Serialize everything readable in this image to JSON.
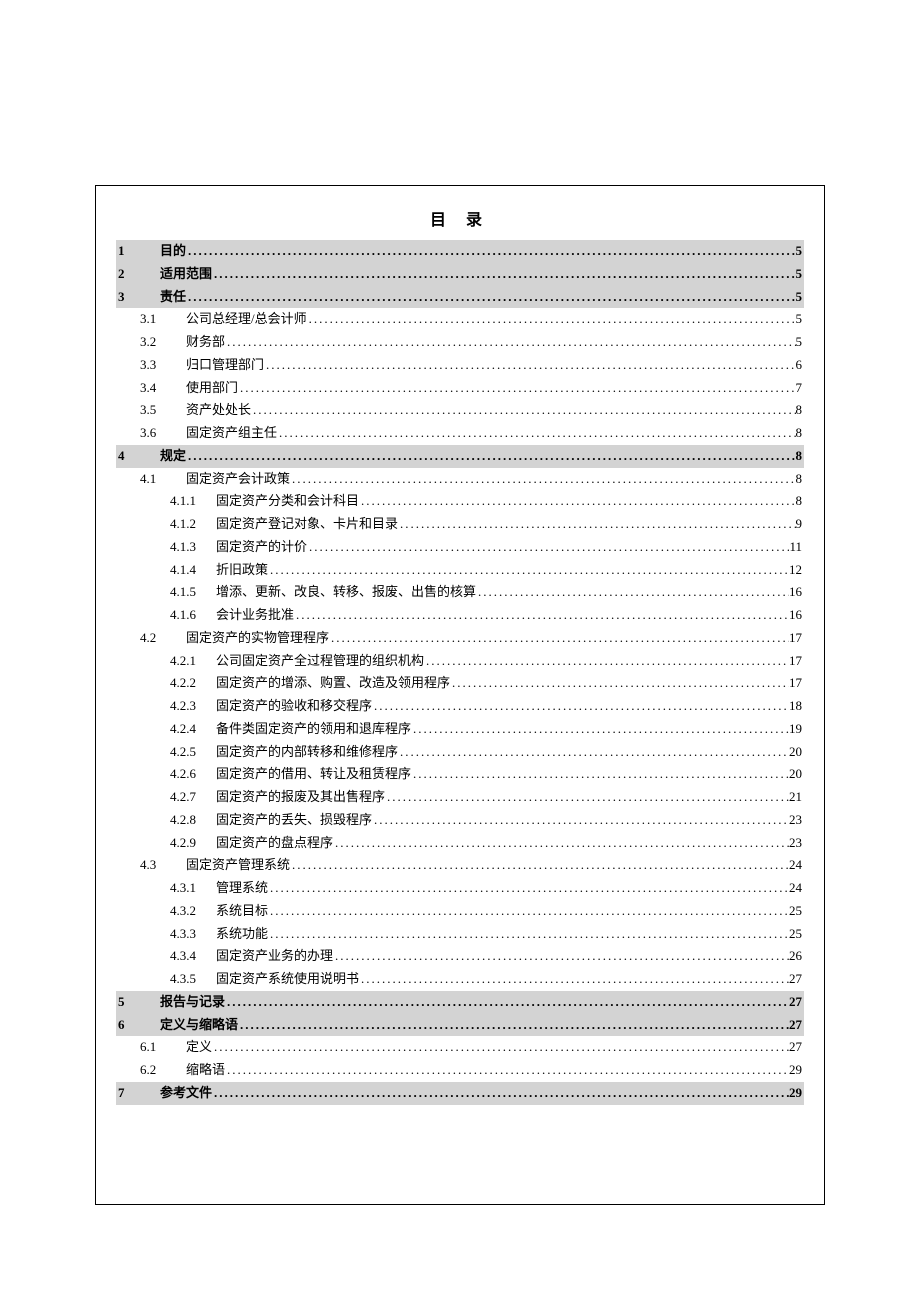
{
  "title": "目 录",
  "toc": [
    {
      "level": 1,
      "num": "1",
      "title": "目的",
      "page": "5"
    },
    {
      "level": 1,
      "num": "2",
      "title": "适用范围",
      "page": "5"
    },
    {
      "level": 1,
      "num": "3",
      "title": "责任",
      "page": "5"
    },
    {
      "level": 2,
      "num": "3.1",
      "title": "公司总经理/总会计师",
      "page": "5"
    },
    {
      "level": 2,
      "num": "3.2",
      "title": "财务部",
      "page": "5"
    },
    {
      "level": 2,
      "num": "3.3",
      "title": "归口管理部门",
      "page": "6"
    },
    {
      "level": 2,
      "num": "3.4",
      "title": "使用部门",
      "page": "7"
    },
    {
      "level": 2,
      "num": "3.5",
      "title": "资产处处长",
      "page": "8"
    },
    {
      "level": 2,
      "num": "3.6",
      "title": "固定资产组主任",
      "page": "8"
    },
    {
      "level": 1,
      "num": "4",
      "title": "规定",
      "page": "8"
    },
    {
      "level": 2,
      "num": "4.1",
      "title": "固定资产会计政策",
      "page": "8"
    },
    {
      "level": 3,
      "num": "4.1.1",
      "title": "固定资产分类和会计科目",
      "page": "8"
    },
    {
      "level": 3,
      "num": "4.1.2",
      "title": "固定资产登记对象、卡片和目录",
      "page": "9"
    },
    {
      "level": 3,
      "num": "4.1.3",
      "title": "固定资产的计价",
      "page": "11"
    },
    {
      "level": 3,
      "num": "4.1.4",
      "title": "折旧政策",
      "page": "12"
    },
    {
      "level": 3,
      "num": "4.1.5",
      "title": "增添、更新、改良、转移、报废、出售的核算",
      "page": "16"
    },
    {
      "level": 3,
      "num": "4.1.6",
      "title": "会计业务批准",
      "page": "16"
    },
    {
      "level": 2,
      "num": "4.2",
      "title": "固定资产的实物管理程序",
      "page": "17"
    },
    {
      "level": 3,
      "num": "4.2.1",
      "title": "公司固定资产全过程管理的组织机构",
      "page": "17"
    },
    {
      "level": 3,
      "num": "4.2.2",
      "title": "固定资产的增添、购置、改造及领用程序",
      "page": "17"
    },
    {
      "level": 3,
      "num": "4.2.3",
      "title": "固定资产的验收和移交程序",
      "page": "18"
    },
    {
      "level": 3,
      "num": "4.2.4",
      "title": "备件类固定资产的领用和退库程序",
      "page": "19"
    },
    {
      "level": 3,
      "num": "4.2.5",
      "title": "固定资产的内部转移和维修程序",
      "page": "20"
    },
    {
      "level": 3,
      "num": "4.2.6",
      "title": "固定资产的借用、转让及租赁程序",
      "page": "20"
    },
    {
      "level": 3,
      "num": "4.2.7",
      "title": "固定资产的报废及其出售程序",
      "page": "21"
    },
    {
      "level": 3,
      "num": "4.2.8",
      "title": "固定资产的丢失、损毁程序",
      "page": "23"
    },
    {
      "level": 3,
      "num": "4.2.9",
      "title": "固定资产的盘点程序",
      "page": "23"
    },
    {
      "level": 2,
      "num": "4.3",
      "title": "固定资产管理系统",
      "page": "24"
    },
    {
      "level": 3,
      "num": "4.3.1",
      "title": "管理系统",
      "page": "24"
    },
    {
      "level": 3,
      "num": "4.3.2",
      "title": "系统目标",
      "page": "25"
    },
    {
      "level": 3,
      "num": "4.3.3",
      "title": "系统功能",
      "page": "25"
    },
    {
      "level": 3,
      "num": "4.3.4",
      "title": "固定资产业务的办理",
      "page": "26"
    },
    {
      "level": 3,
      "num": "4.3.5",
      "title": "固定资产系统使用说明书",
      "page": "27"
    },
    {
      "level": 1,
      "num": "5",
      "title": "报告与记录",
      "page": "27"
    },
    {
      "level": 1,
      "num": "6",
      "title": "定义与缩略语",
      "page": "27"
    },
    {
      "level": 2,
      "num": "6.1",
      "title": "定义",
      "page": "27"
    },
    {
      "level": 2,
      "num": "6.2",
      "title": "缩略语",
      "page": "29"
    },
    {
      "level": 1,
      "num": "7",
      "title": "参考文件",
      "page": "29"
    }
  ]
}
